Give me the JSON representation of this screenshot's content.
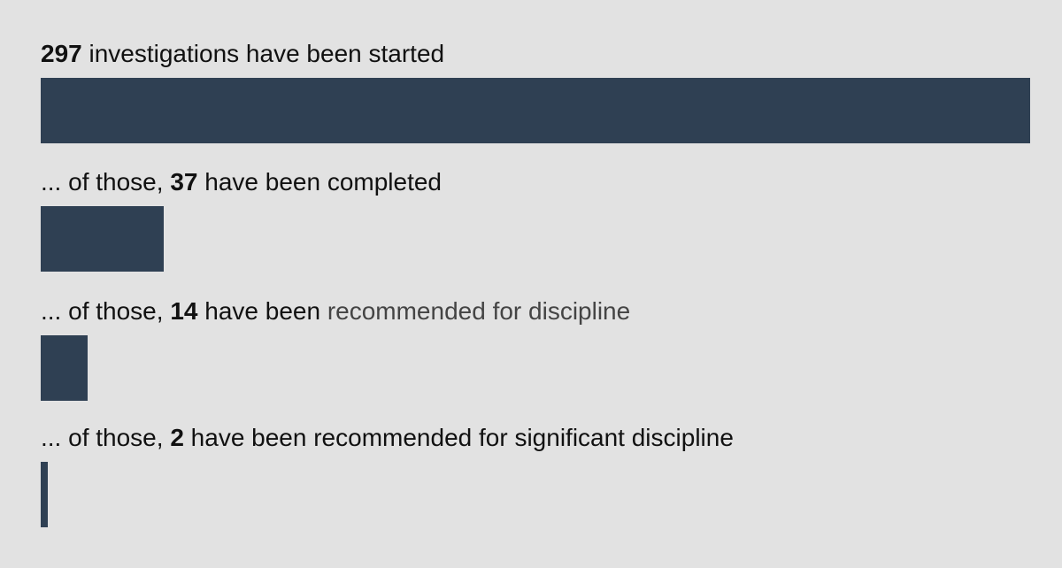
{
  "chart_data": {
    "type": "bar",
    "orientation": "horizontal",
    "color": "#2f4053",
    "max": 297,
    "rows": [
      {
        "value": 297,
        "prefix": "",
        "number": "297",
        "suffix": " investigations have been started",
        "muted": ""
      },
      {
        "value": 37,
        "prefix": "... of those, ",
        "number": "37",
        "suffix": " have been completed",
        "muted": ""
      },
      {
        "value": 14,
        "prefix": "... of those, ",
        "number": "14",
        "suffix": " have been ",
        "muted": "recommended for discipline"
      },
      {
        "value": 2,
        "prefix": "... of those, ",
        "number": "2",
        "suffix": " have been recommended for significant discipline",
        "muted": ""
      }
    ]
  }
}
